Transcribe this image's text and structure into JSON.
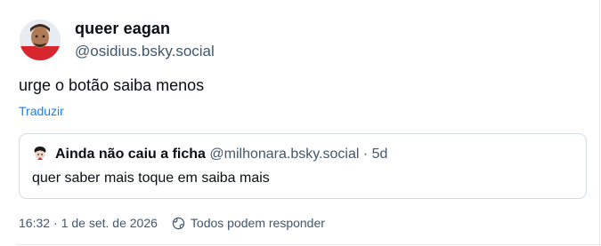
{
  "post": {
    "author": {
      "display_name": "queer eagan",
      "handle": "@osidius.bsky.social"
    },
    "text": "urge o botão saiba menos",
    "translate_label": "Traduzir",
    "quote": {
      "author": "Ainda não caiu a ficha",
      "handle": "@milhonara.bsky.social",
      "separator": "·",
      "time": "5d",
      "text": "quer saber mais toque em saiba mais"
    },
    "meta": {
      "timestamp": "16:32",
      "separator": "·",
      "date": "1 de set. de 2026",
      "reply_setting": "Todos podem responder",
      "reply_icon": "globe-icon"
    }
  },
  "colors": {
    "text": "#0b0f14",
    "secondary": "#42566d",
    "link": "#1083fe",
    "border": "#d4dbe2"
  }
}
